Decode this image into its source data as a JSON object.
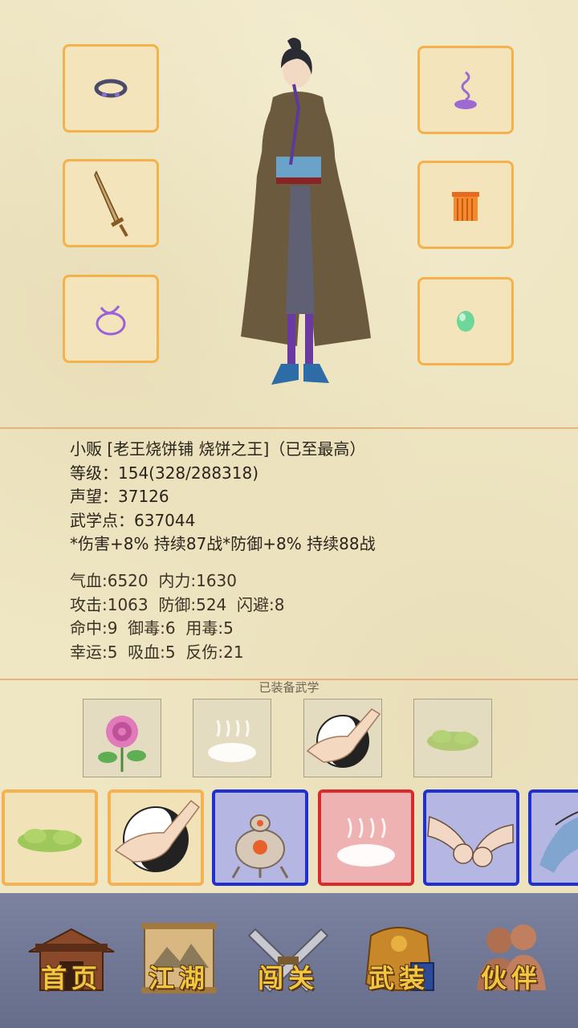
{
  "equipment": {
    "left": [
      "ring-icon",
      "sword-icon",
      "bracelet-icon"
    ],
    "right": [
      "incense-icon",
      "sash-icon",
      "jade-icon"
    ]
  },
  "hero": {
    "title_line": "小贩 [老王烧饼铺 烧饼之王]（已至最高）",
    "level_line": "等级：154(328/288318)",
    "prestige_line": "声望：37126",
    "martial_points_line": "武学点：637044",
    "buff_line": "*伤害+8% 持续87战*防御+8% 持续88战"
  },
  "stats": {
    "row1": "气血:6520  内力:1630",
    "row2": "攻击:1063  防御:524  闪避:8",
    "row3": "命中:9  御毒:6  用毒:5",
    "row4": "幸运:5  吸血:5  反伤:21"
  },
  "equipped_caption": "已装备武学",
  "skills_equipped": [
    "rose-icon",
    "mist-icon",
    "taiji-palm-icon",
    "green-cloud-icon"
  ],
  "skill_cards": [
    {
      "icon": "green-cloud-icon",
      "rarity": "gold"
    },
    {
      "icon": "taiji-palm-icon",
      "rarity": "gold"
    },
    {
      "icon": "bronze-censer-icon",
      "rarity": "blue"
    },
    {
      "icon": "red-mist-icon",
      "rarity": "red"
    },
    {
      "icon": "fist-clash-icon",
      "rarity": "blue"
    },
    {
      "icon": "blue-hand-icon",
      "rarity": "blue"
    }
  ],
  "nav": {
    "home": "首页",
    "jianghu": "江湖",
    "challenge": "闯关",
    "equip": "武装",
    "partner": "伙伴"
  },
  "colors": {
    "slot_border": "#f5b24a",
    "rarity_gold": "#f6b152",
    "rarity_blue": "#1f2fd0",
    "rarity_red": "#d82a2a",
    "nav_bg": "#6f7694",
    "nav_text": "#f3c640"
  }
}
